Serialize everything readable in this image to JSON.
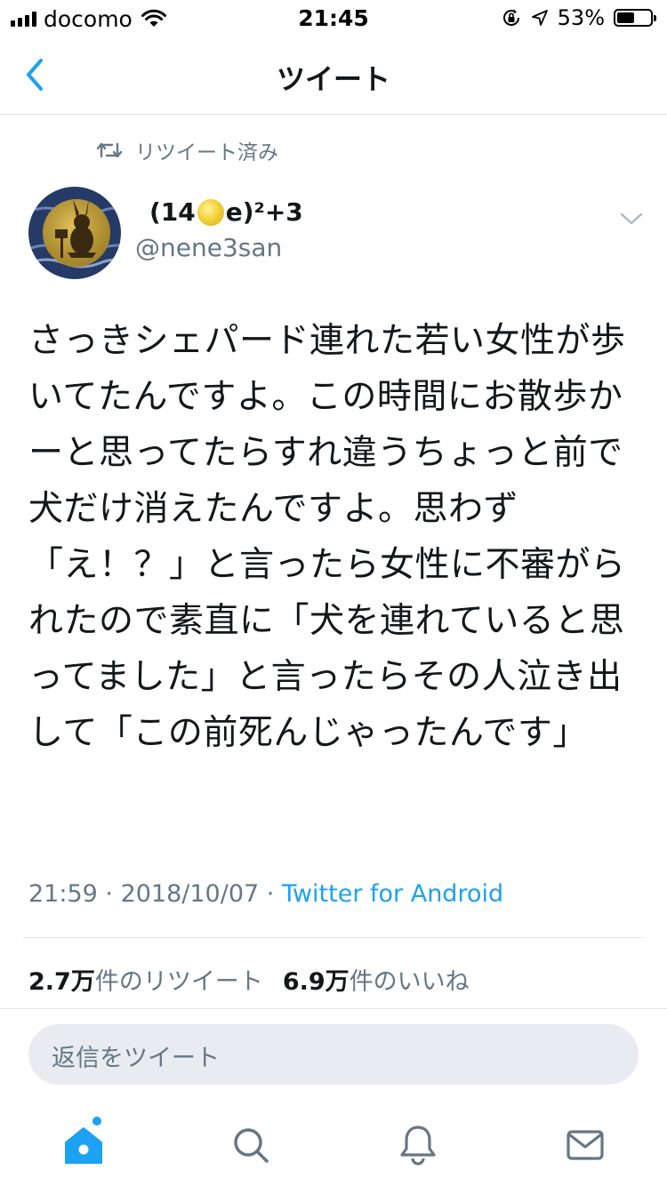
{
  "status_bar": {
    "carrier": "docomo",
    "time": "21:45",
    "battery_percent": "53%",
    "battery_level": 0.53
  },
  "nav": {
    "title": "ツイート"
  },
  "retweet_notice": "リツイート済み",
  "author": {
    "name_prefix": "(14",
    "name_suffix": "e)²+3",
    "handle": "@nene3san"
  },
  "tweet": {
    "text": "さっきシェパード連れた若い女性が歩いてたんですよ。この時間にお散歩かーと思ってたらすれ違うちょっと前で犬だけ消えたんですよ。思わず「え！？」と言ったら女性に不審がられたので素直に「犬を連れていると思ってました」と言ったらその人泣き出して「この前死んじゃったんです」",
    "time": "21:59",
    "date": "2018/10/07",
    "separator": " · ",
    "source": "Twitter for Android"
  },
  "stats": {
    "retweets_count": "2.7万",
    "retweets_label": "件のリツイート",
    "likes_count": "6.9万",
    "likes_label": "件のいいね"
  },
  "reply": {
    "placeholder": "返信をツイート"
  },
  "tab_bar": {
    "tabs": [
      "home-icon",
      "search-icon",
      "notifications-icon",
      "messages-icon"
    ],
    "active": "home-icon"
  },
  "colors": {
    "accent": "#1da1f2",
    "secondary_text": "#657786",
    "divider": "#e1e8ed"
  }
}
